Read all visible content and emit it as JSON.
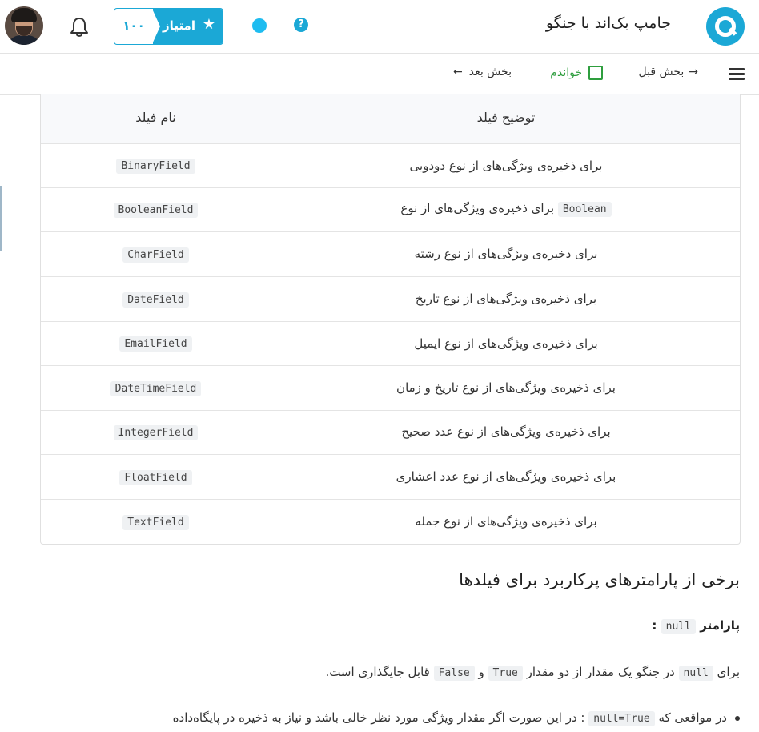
{
  "header": {
    "app_title": "جامپ بک‌اند با جنگو",
    "score_label": "امتیاز",
    "score_value": "۱۰۰",
    "help_glyph": "?",
    "icons": {
      "logo": "quera-logo-icon",
      "help": "help-icon",
      "status": "status-dot-icon",
      "star": "star-icon",
      "bell": "bell-icon",
      "avatar": "user-avatar"
    },
    "accent_color": "#1ba8d6"
  },
  "subnav": {
    "prev_label": "بخش قبل",
    "next_label": "بخش بعد",
    "read_label": "خواندم",
    "read_checked": false
  },
  "table": {
    "headers": {
      "description": "توضیح فیلد",
      "name": "نام فیلد"
    },
    "rows": [
      {
        "description": "برای ذخیره‌ی ویژگی‌های از نوع دودویی",
        "name": "BinaryField"
      },
      {
        "description_pre": "برای ذخیره‌ی ویژگی‌های از نوع",
        "description_code": "Boolean",
        "name": "BooleanField"
      },
      {
        "description": "برای ذخیره‌ی ویژگی‌های از نوع رشته",
        "name": "CharField"
      },
      {
        "description": "برای ذخیره‌ی ویژگی‌های از نوع تاریخ",
        "name": "DateField"
      },
      {
        "description": "برای ذخیره‌ی ویژگی‌های از نوع ایمیل",
        "name": "EmailField"
      },
      {
        "description": "برای ذخیره‌ی ویژگی‌های از نوع تاریخ و زمان",
        "name": "DateTimeField"
      },
      {
        "description": "برای ذخیره‌ی ویژگی‌های از نوع عدد صحیح",
        "name": "IntegerField"
      },
      {
        "description": "برای ذخیره‌ی ویژگی‌های از نوع عدد اعشاری",
        "name": "FloatField"
      },
      {
        "description": "برای ذخیره‌ی ویژگی‌های از نوع جمله",
        "name": "TextField"
      }
    ]
  },
  "article": {
    "heading": "برخی از پارامترهای پرکاربرد برای فیلدها",
    "param_label": "پارامتر",
    "param_code": "null",
    "param_suffix": " :",
    "para": {
      "t1": "برای",
      "c1": "null",
      "t2": "در جنگو یک مقدار از دو مقدار",
      "c2": "True",
      "t3": "و",
      "c3": "False",
      "t4": "قابل جایگذاری است."
    },
    "bullet": {
      "t1": "در مواقعی که",
      "c1": "null=True",
      "t2": ": در این صورت اگر مقدار ویژگی مورد نظر خالی باشد و نیاز به ذخیره در پایگاه‌داده"
    }
  }
}
